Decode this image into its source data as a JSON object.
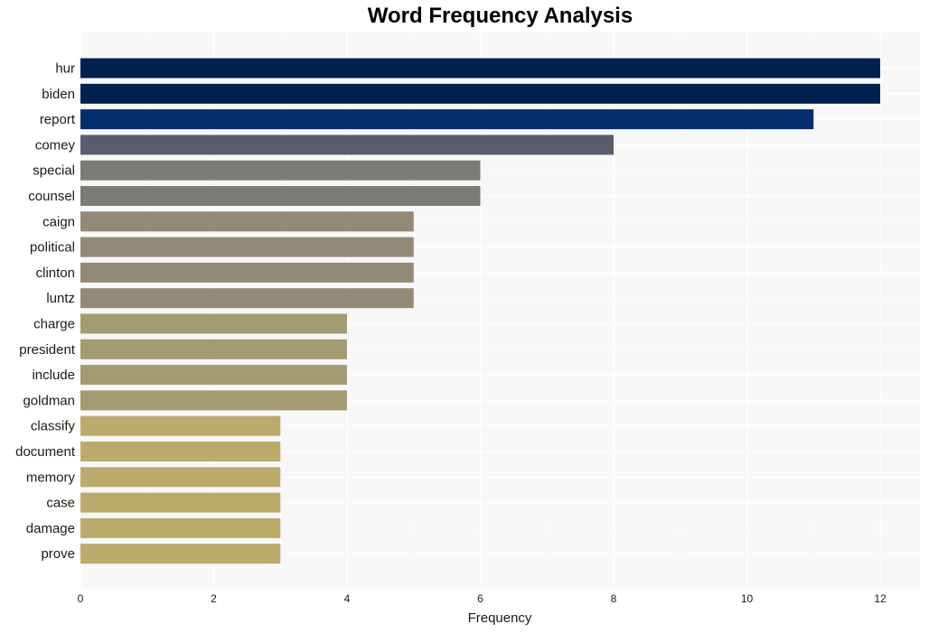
{
  "chart_data": {
    "type": "bar",
    "orientation": "horizontal",
    "title": "Word Frequency Analysis",
    "xlabel": "Frequency",
    "ylabel": "",
    "xlim": [
      0,
      12.6
    ],
    "xticks": [
      0,
      2,
      4,
      6,
      8,
      10,
      12
    ],
    "grid": true,
    "legend": "none",
    "categories": [
      "hur",
      "biden",
      "report",
      "comey",
      "special",
      "counsel",
      "caign",
      "political",
      "clinton",
      "luntz",
      "charge",
      "president",
      "include",
      "goldman",
      "classify",
      "document",
      "memory",
      "case",
      "damage",
      "prove"
    ],
    "values": [
      12,
      12,
      11,
      8,
      6,
      6,
      5,
      5,
      5,
      5,
      4,
      4,
      4,
      4,
      3,
      3,
      3,
      3,
      3,
      3
    ],
    "colors": [
      "#00214d",
      "#00214d",
      "#002f6c",
      "#595d6e",
      "#7c7b78",
      "#7c7b78",
      "#918a77",
      "#918a77",
      "#918a77",
      "#918a77",
      "#a39b71",
      "#a39b71",
      "#a39b71",
      "#a39b71",
      "#baab6d",
      "#baab6d",
      "#baab6d",
      "#baab6d",
      "#baab6d",
      "#baab6d"
    ],
    "background_color": "#f7f7f7",
    "grid_color": "#ffffff"
  }
}
